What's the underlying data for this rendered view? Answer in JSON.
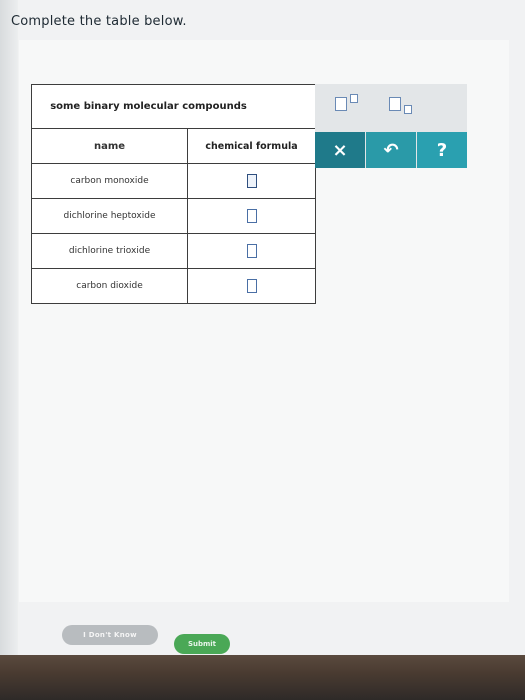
{
  "prompt": "Complete the table below.",
  "table": {
    "title": "some binary molecular compounds",
    "header": {
      "name": "name",
      "formula": "chemical formula"
    },
    "rows": [
      {
        "name": "carbon monoxide",
        "formula": ""
      },
      {
        "name": "dichlorine heptoxide",
        "formula": ""
      },
      {
        "name": "dichlorine trioxide",
        "formula": ""
      },
      {
        "name": "carbon dioxide",
        "formula": ""
      }
    ]
  },
  "toolbar": {
    "superscript_icon": "superscript-box-icon",
    "subscript_icon": "subscript-box-icon",
    "clear_label": "×",
    "undo_label": "↶",
    "help_label": "?"
  },
  "buttons": {
    "dont_know": "I Don't Know",
    "submit": "Submit"
  },
  "colors": {
    "clear": "#1f7a8a",
    "undo": "#2a9aa8",
    "help": "#2aa0b0",
    "submit": "#4aa856"
  }
}
